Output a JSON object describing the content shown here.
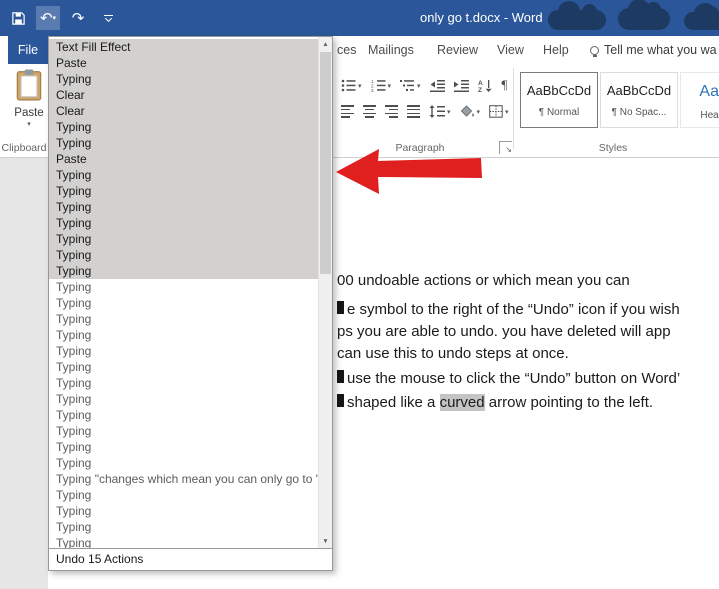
{
  "colors": {
    "titlebar_blue": "#2b579a",
    "annotation_red": "#e01f1f",
    "undo_selection_gray": "#d2d1d0",
    "text_highlight_gray": "#c4c4c4"
  },
  "titlebar": {
    "title": "only go t.docx - Word"
  },
  "icons": {
    "undo": "↶",
    "redo": "↷",
    "caret": "▾",
    "scroll_up": "▲",
    "scroll_down": "▼",
    "pilcrow": "¶",
    "dialog_launcher": "↘"
  },
  "tabs": {
    "file": "File",
    "fragment": "ces",
    "items": [
      "Mailings",
      "Review",
      "View",
      "Help"
    ],
    "tellme": "Tell me what you wa"
  },
  "ribbon": {
    "paste": {
      "label": "Paste"
    },
    "groups": {
      "clipboard": "Clipboard",
      "paragraph": "Paragraph",
      "styles": "Styles"
    },
    "styles": [
      {
        "sample": "AaBbCcDd",
        "name": "¶ Normal"
      },
      {
        "sample": "AaBbCcDd",
        "name": "¶ No Spac..."
      },
      {
        "sample": "AaBb",
        "name": "Heading"
      }
    ]
  },
  "undo_dropdown": {
    "footer": "Undo 15 Actions",
    "items": [
      {
        "label": "Text Fill Effect",
        "selected": true
      },
      {
        "label": "Paste",
        "selected": true
      },
      {
        "label": "Typing",
        "selected": true
      },
      {
        "label": "Clear",
        "selected": true
      },
      {
        "label": "Clear",
        "selected": true
      },
      {
        "label": "Typing",
        "selected": true
      },
      {
        "label": "Typing",
        "selected": true
      },
      {
        "label": "Paste",
        "selected": true
      },
      {
        "label": "Typing",
        "selected": true
      },
      {
        "label": "Typing",
        "selected": true
      },
      {
        "label": "Typing",
        "selected": true
      },
      {
        "label": "Typing",
        "selected": true
      },
      {
        "label": "Typing",
        "selected": true
      },
      {
        "label": "Typing",
        "selected": true
      },
      {
        "label": "Typing",
        "selected": true
      },
      {
        "label": "Typing",
        "selected": false
      },
      {
        "label": "Typing",
        "selected": false
      },
      {
        "label": "Typing",
        "selected": false
      },
      {
        "label": "Typing",
        "selected": false
      },
      {
        "label": "Typing",
        "selected": false
      },
      {
        "label": "Typing",
        "selected": false
      },
      {
        "label": "Typing",
        "selected": false
      },
      {
        "label": "Typing",
        "selected": false
      },
      {
        "label": "Typing",
        "selected": false
      },
      {
        "label": "Typing",
        "selected": false
      },
      {
        "label": "Typing",
        "selected": false
      },
      {
        "label": "Typing",
        "selected": false
      },
      {
        "label": "Typing \"changes which mean you can only go to \"",
        "selected": false
      },
      {
        "label": "Typing",
        "selected": false
      },
      {
        "label": "Typing",
        "selected": false
      },
      {
        "label": "Typing",
        "selected": false
      },
      {
        "label": "Typing",
        "selected": false
      }
    ]
  },
  "document": {
    "lines": [
      {
        "cut": false,
        "text": "00 undoable actions or which mean you can"
      },
      {
        "cut": true,
        "text": "e symbol to the right of the “Undo” icon if you wish"
      },
      {
        "cut": false,
        "text": "ps you are able to undo. you have deleted will app"
      },
      {
        "cut": false,
        "text": "can use this to undo steps at once."
      },
      {
        "cut": true,
        "text": "use the mouse to click the “Undo” button on Word’"
      },
      {
        "cut": true,
        "pre": "shaped like a ",
        "highlight": "curved",
        "post": " arrow pointing to the left."
      }
    ]
  }
}
